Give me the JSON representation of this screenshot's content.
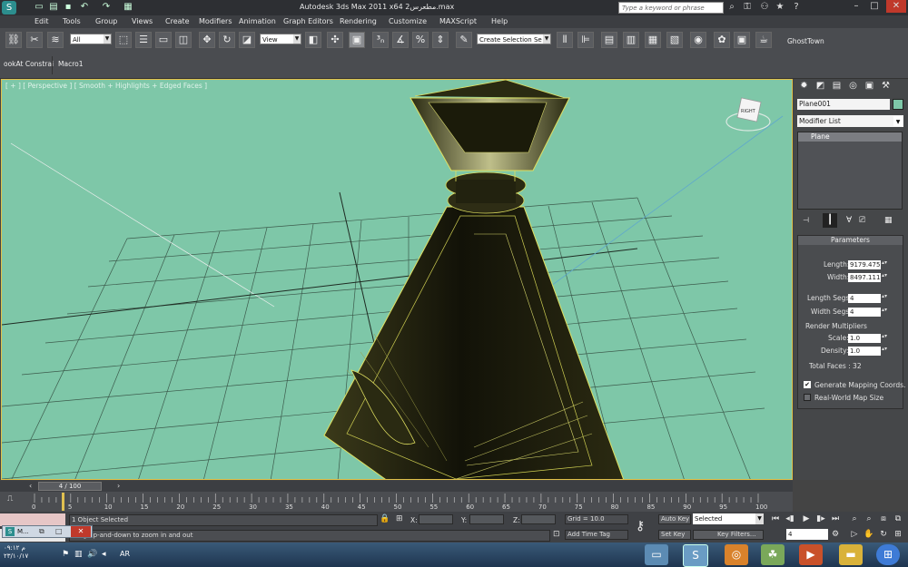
{
  "window": {
    "title": "Autodesk 3ds Max  2011 x64    مطعرس2.max",
    "search_placeholder": "Type a keyword or phrase"
  },
  "menu": [
    "Edit",
    "Tools",
    "Group",
    "Views",
    "Create",
    "Modifiers",
    "Animation",
    "Graph Editors",
    "Rendering",
    "Customize",
    "MAXScript",
    "Help"
  ],
  "toolbar": {
    "filter_value": "All",
    "ref_coord_value": "View",
    "selection_set_value": "Create Selection Se",
    "ghosttown_label": "GhostTown"
  },
  "subtoolbar": {
    "tabs": [
      "ookAt Constrai",
      "Macro1"
    ]
  },
  "viewport": {
    "label": "[ + ] [ Perspective ] [ Smooth + Highlights + Edged Faces ]",
    "viewcube_label": "RIGHT"
  },
  "command_panel": {
    "object_name": "Plane001",
    "object_color": "#7ec7a8",
    "modifier_list_label": "Modifier List",
    "stack_items": [
      "Plane"
    ],
    "rollout_title": "Parameters",
    "length_label": "Length:",
    "length_value": "9179.475",
    "width_label": "Width:",
    "width_value": "8497.111",
    "length_segs_label": "Length Segs:",
    "length_segs_value": "4",
    "width_segs_label": "Width Segs:",
    "width_segs_value": "4",
    "render_multipliers_label": "Render Multipliers",
    "scale_label": "Scale:",
    "scale_value": "1.0",
    "density_label": "Density:",
    "density_value": "1.0",
    "total_faces": "Total Faces : 32",
    "generate_mapping_label": "Generate Mapping Coords.",
    "generate_mapping_checked": true,
    "real_world_label": "Real-World Map Size",
    "real_world_checked": false
  },
  "timeline": {
    "frame_display": "4 / 100",
    "ticks": [
      "0",
      "5",
      "10",
      "15",
      "20",
      "25",
      "30",
      "35",
      "40",
      "45",
      "50",
      "55",
      "60",
      "65",
      "70",
      "75",
      "80",
      "85",
      "90",
      "95",
      "100"
    ]
  },
  "status": {
    "selection": "1 Object Selected",
    "prompt": "Drag up-and-down to zoom in and out",
    "x_label": "X:",
    "y_label": "Y:",
    "z_label": "Z:",
    "grid": "Grid = 10.0",
    "add_time_tag": "Add Time Tag",
    "auto_key": "Auto Key",
    "set_key": "Set Key",
    "key_mode_value": "Selected",
    "key_filters": "Key Filters...",
    "frame_value": "4",
    "mini_listener": "M..."
  },
  "taskbar": {
    "language": "AR",
    "time": "م ٠٩:١٢",
    "date": "٢٣/١٠/١٧"
  }
}
